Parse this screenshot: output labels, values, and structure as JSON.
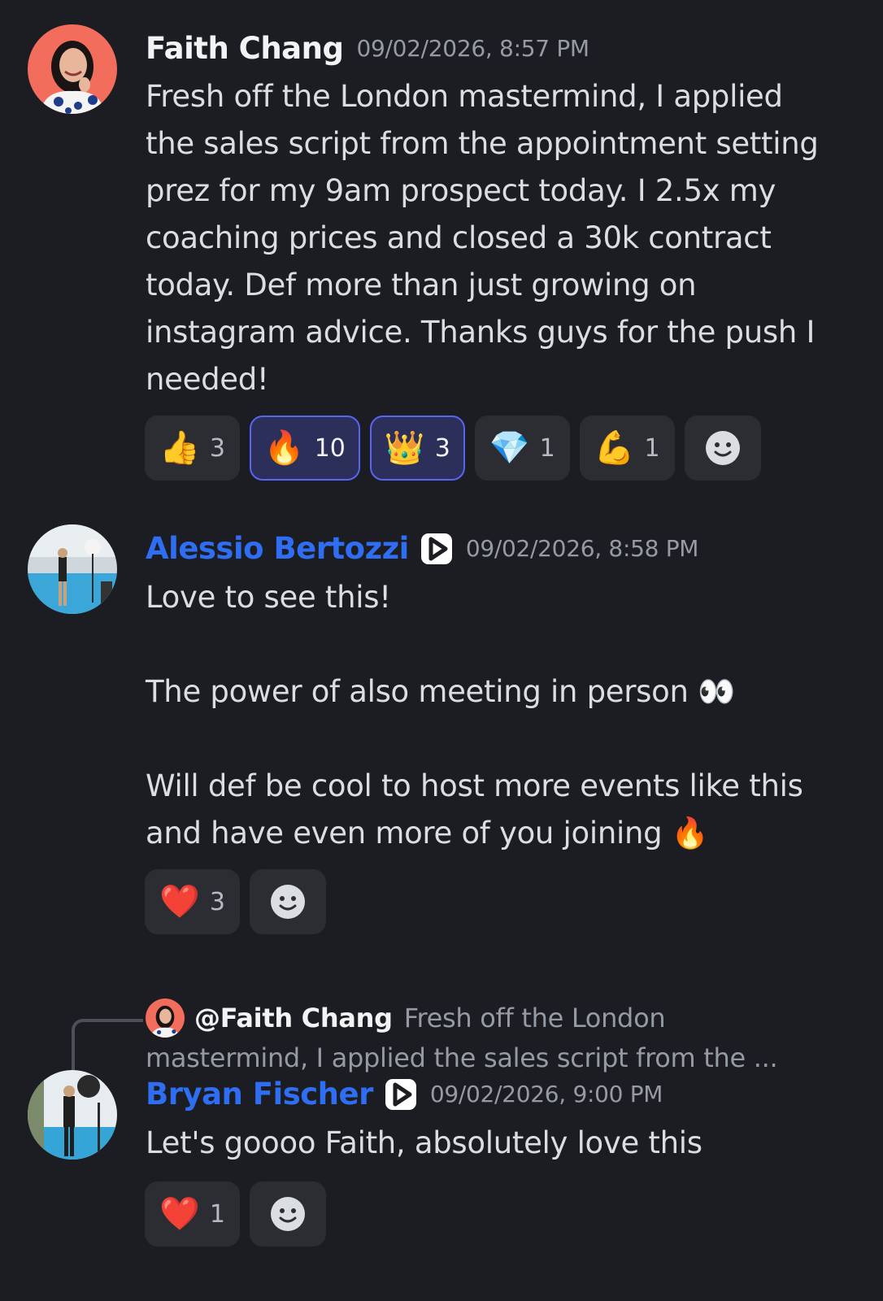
{
  "messages": [
    {
      "author": "Faith Chang",
      "timestamp": "09/02/2026, 8:57 PM",
      "lines": [
        "Fresh off the London mastermind, I applied",
        "the sales script from the appointment setting",
        "prez for my 9am prospect today. I 2.5x my",
        "coaching prices and closed a 30k contract",
        "today. Def more than just growing on",
        "instagram advice. Thanks guys for the push I",
        "needed!"
      ],
      "reactions": [
        {
          "emoji": "👍",
          "count": "3",
          "active": false
        },
        {
          "emoji": "🔥",
          "count": "10",
          "active": true
        },
        {
          "emoji": "👑",
          "count": "3",
          "active": true
        },
        {
          "emoji": "💎",
          "count": "1",
          "active": false
        },
        {
          "emoji": "💪",
          "count": "1",
          "active": false
        }
      ]
    },
    {
      "author": "Alessio Bertozzi",
      "timestamp": "09/02/2026, 8:58 PM",
      "line1": "Love to see this!",
      "line2": "The power of also meeting in person 👀",
      "line3": "Will def be cool to host more events like this",
      "line4": "and have even more of you joining 🔥",
      "reactions": [
        {
          "emoji": "❤️",
          "count": "3",
          "active": false
        }
      ]
    },
    {
      "reply_to_name": "@Faith Chang",
      "reply_to_text_1": "Fresh off the London",
      "reply_to_text_2": "mastermind, I applied the sales script from the ...",
      "author": "Bryan Fischer",
      "timestamp": "09/02/2026, 9:00 PM",
      "text": "Let's goooo Faith, absolutely love this",
      "reactions": [
        {
          "emoji": "❤️",
          "count": "1",
          "active": false
        }
      ]
    }
  ],
  "icons": {
    "badge": "play-badge-icon",
    "add_reaction": "smiley-add-reaction-icon"
  },
  "colors": {
    "background": "#1c1d22",
    "author_blue": "#2f6ef2",
    "reaction_active_border": "#5865f2"
  }
}
